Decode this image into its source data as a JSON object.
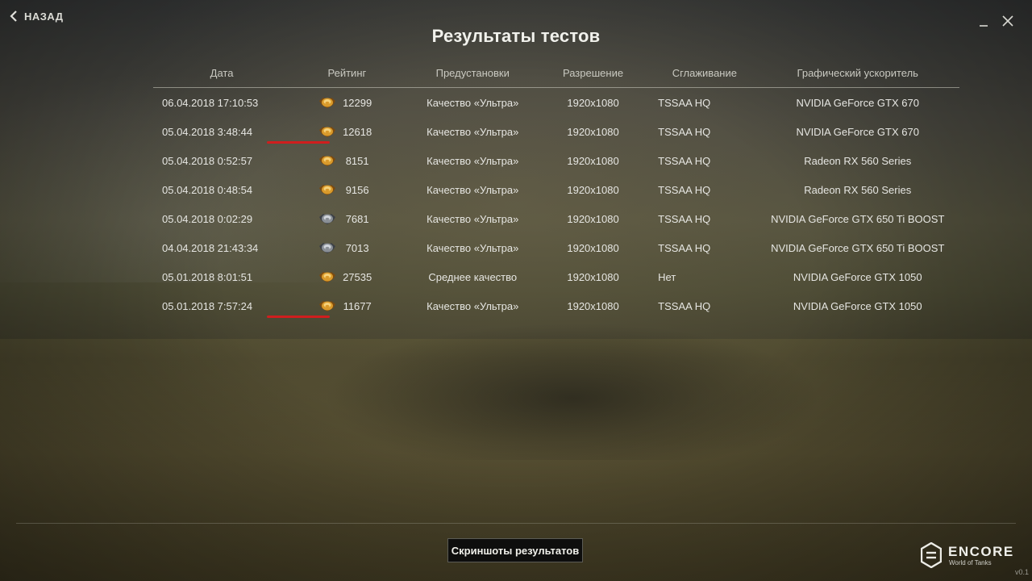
{
  "nav": {
    "back_label": "НАЗАД"
  },
  "title": "Результаты тестов",
  "table": {
    "headers": {
      "date": "Дата",
      "rating": "Рейтинг",
      "preset": "Предустановки",
      "resolution": "Разрешение",
      "antialiasing": "Сглаживание",
      "gpu": "Графический ускоритель"
    },
    "rows": [
      {
        "date": "06.04.2018 17:10:53",
        "rating": "12299",
        "medal": "gold-medal-icon",
        "preset": "Качество «Ультра»",
        "resolution": "1920x1080",
        "antialiasing": "TSSAA HQ",
        "gpu": "NVIDIA GeForce GTX 670"
      },
      {
        "date": "05.04.2018 3:48:44",
        "rating": "12618",
        "medal": "gold-medal-icon",
        "preset": "Качество «Ультра»",
        "resolution": "1920x1080",
        "antialiasing": "TSSAA HQ",
        "gpu": "NVIDIA GeForce GTX 670"
      },
      {
        "date": "05.04.2018 0:52:57",
        "rating": "8151",
        "medal": "gold-medal-icon",
        "preset": "Качество «Ультра»",
        "resolution": "1920x1080",
        "antialiasing": "TSSAA HQ",
        "gpu": "Radeon RX 560 Series"
      },
      {
        "date": "05.04.2018 0:48:54",
        "rating": "9156",
        "medal": "gold-medal-icon",
        "preset": "Качество «Ультра»",
        "resolution": "1920x1080",
        "antialiasing": "TSSAA HQ",
        "gpu": "Radeon RX 560 Series"
      },
      {
        "date": "05.04.2018 0:02:29",
        "rating": "7681",
        "medal": "silver-medal-icon",
        "preset": "Качество «Ультра»",
        "resolution": "1920x1080",
        "antialiasing": "TSSAA HQ",
        "gpu": "NVIDIA GeForce GTX 650 Ti BOOST"
      },
      {
        "date": "04.04.2018 21:43:34",
        "rating": "7013",
        "medal": "silver-medal-icon",
        "preset": "Качество «Ультра»",
        "resolution": "1920x1080",
        "antialiasing": "TSSAA HQ",
        "gpu": "NVIDIA GeForce GTX 650 Ti BOOST"
      },
      {
        "date": "05.01.2018 8:01:51",
        "rating": "27535",
        "medal": "gold-medal-icon",
        "preset": "Среднее качество",
        "resolution": "1920x1080",
        "antialiasing": "Нет",
        "gpu": "NVIDIA GeForce GTX 1050"
      },
      {
        "date": "05.01.2018 7:57:24",
        "rating": "11677",
        "medal": "gold-medal-icon",
        "preset": "Качество «Ультра»",
        "resolution": "1920x1080",
        "antialiasing": "TSSAA HQ",
        "gpu": "NVIDIA GeForce GTX 1050"
      }
    ]
  },
  "highlight_color": "#d01e1e",
  "footer": {
    "screenshots_button": "Скриншоты результатов",
    "logo_brand": "ENCORE",
    "logo_sub": "World of Tanks",
    "version": "v0.1"
  }
}
